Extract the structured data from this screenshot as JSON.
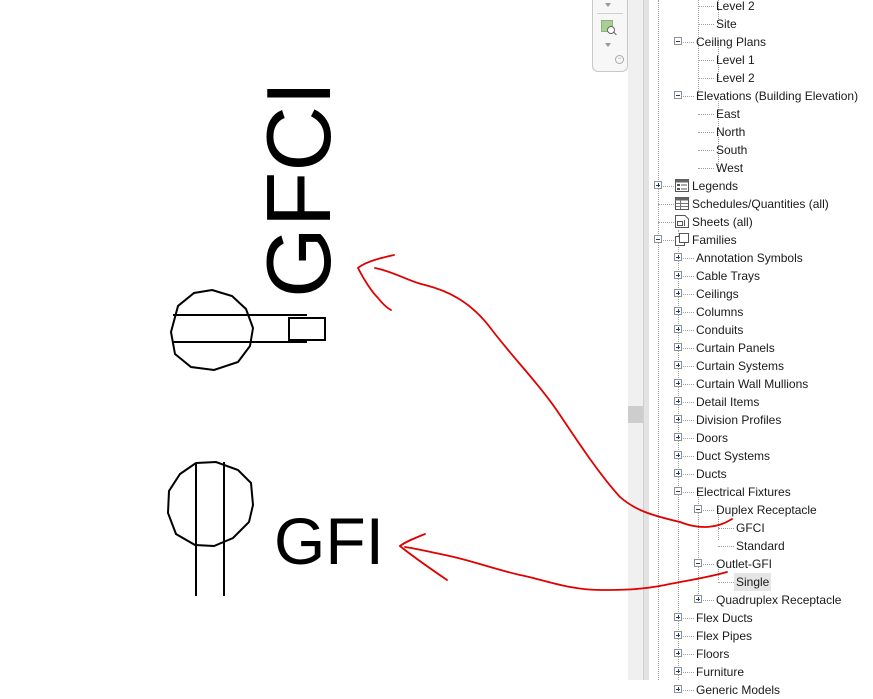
{
  "canvas": {
    "gfci_tag": "GFCI",
    "gfi_tag": "GFI",
    "annotation_color": "#e00000"
  },
  "navigation_bar": {
    "icons": [
      "scroll-down-arrow",
      "zoom-region-icon",
      "scroll-down-arrow",
      "minimize-icon"
    ]
  },
  "project_browser": {
    "rows": [
      {
        "label": "Level 2",
        "depth": 3,
        "expander": "none"
      },
      {
        "label": "Site",
        "depth": 3,
        "expander": "none"
      },
      {
        "label": "Ceiling Plans",
        "depth": 2,
        "expander": "minus"
      },
      {
        "label": "Level 1",
        "depth": 3,
        "expander": "none"
      },
      {
        "label": "Level 2",
        "depth": 3,
        "expander": "none"
      },
      {
        "label": "Elevations (Building Elevation)",
        "depth": 2,
        "expander": "minus"
      },
      {
        "label": "East",
        "depth": 3,
        "expander": "none"
      },
      {
        "label": "North",
        "depth": 3,
        "expander": "none"
      },
      {
        "label": "South",
        "depth": 3,
        "expander": "none"
      },
      {
        "label": "West",
        "depth": 3,
        "expander": "none"
      },
      {
        "label": "Legends",
        "depth": 1,
        "expander": "plus",
        "icon": "legends-icon"
      },
      {
        "label": "Schedules/Quantities (all)",
        "depth": 1,
        "expander": "none",
        "icon": "schedules-icon"
      },
      {
        "label": "Sheets (all)",
        "depth": 1,
        "expander": "none",
        "icon": "sheets-icon"
      },
      {
        "label": "Families",
        "depth": 1,
        "expander": "minus",
        "icon": "families-icon"
      },
      {
        "label": "Annotation Symbols",
        "depth": 2,
        "expander": "plus"
      },
      {
        "label": "Cable Trays",
        "depth": 2,
        "expander": "plus"
      },
      {
        "label": "Ceilings",
        "depth": 2,
        "expander": "plus"
      },
      {
        "label": "Columns",
        "depth": 2,
        "expander": "plus"
      },
      {
        "label": "Conduits",
        "depth": 2,
        "expander": "plus"
      },
      {
        "label": "Curtain Panels",
        "depth": 2,
        "expander": "plus"
      },
      {
        "label": "Curtain Systems",
        "depth": 2,
        "expander": "plus"
      },
      {
        "label": "Curtain Wall Mullions",
        "depth": 2,
        "expander": "plus"
      },
      {
        "label": "Detail Items",
        "depth": 2,
        "expander": "plus"
      },
      {
        "label": "Division Profiles",
        "depth": 2,
        "expander": "plus"
      },
      {
        "label": "Doors",
        "depth": 2,
        "expander": "plus"
      },
      {
        "label": "Duct Systems",
        "depth": 2,
        "expander": "plus"
      },
      {
        "label": "Ducts",
        "depth": 2,
        "expander": "plus"
      },
      {
        "label": "Electrical Fixtures",
        "depth": 2,
        "expander": "minus"
      },
      {
        "label": "Duplex Receptacle",
        "depth": 3,
        "expander": "minus"
      },
      {
        "label": "GFCI",
        "depth": 4,
        "expander": "none"
      },
      {
        "label": "Standard",
        "depth": 4,
        "expander": "none"
      },
      {
        "label": "Outlet-GFI",
        "depth": 3,
        "expander": "minus"
      },
      {
        "label": "Single",
        "depth": 4,
        "expander": "none",
        "selected": true
      },
      {
        "label": "Quadruplex Receptacle",
        "depth": 3,
        "expander": "plus"
      },
      {
        "label": "Flex Ducts",
        "depth": 2,
        "expander": "plus"
      },
      {
        "label": "Flex Pipes",
        "depth": 2,
        "expander": "plus"
      },
      {
        "label": "Floors",
        "depth": 2,
        "expander": "plus"
      },
      {
        "label": "Furniture",
        "depth": 2,
        "expander": "plus"
      },
      {
        "label": "Generic Models",
        "depth": 2,
        "expander": "plus"
      }
    ]
  }
}
